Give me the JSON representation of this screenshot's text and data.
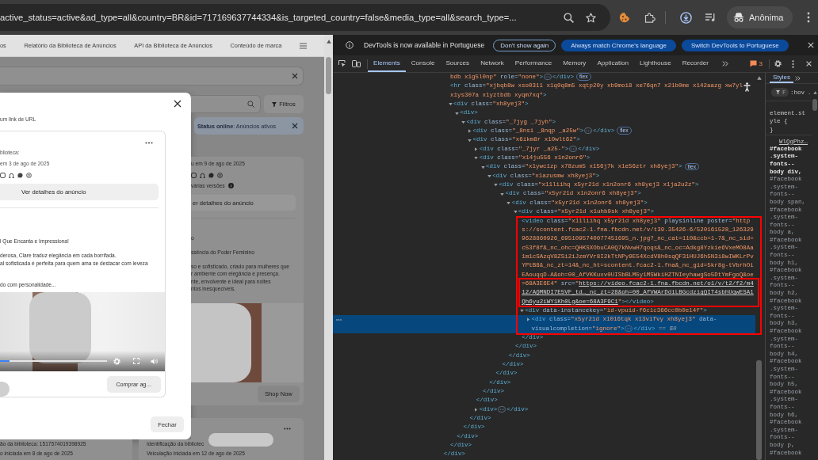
{
  "browser": {
    "url": "active_status=active&ad_type=all&country=BR&id=717169637744334&is_targeted_country=false&media_type=all&search_type=...",
    "profile": "Anônima"
  },
  "page": {
    "nav": [
      "os",
      "Relatório da Biblioteca de Anúncios",
      "API da Biblioteca de Anúncios",
      "Conteúdo de marca"
    ],
    "filters_button": "Filtros",
    "status_chip": "**Status online**: Anúncios ativos",
    "dialog": {
      "subtitle": "um link de URL",
      "ad": {
        "info_lines": [
          "blioteca:",
          "em 3 de ago de 2025"
        ],
        "details_button": "Ver detalhes do anúncio",
        "headline": "l Que Encanta e Impressiona!",
        "paragraphs": [
          [
            "derosa, Clare traduz elegância em cada borrifada.",
            "al sofisticada é perfeita para quem ama se destacar com leveza"
          ],
          [
            "do com personalidade..."
          ]
        ],
        "video_progress": {
          "level": 0.09
        },
        "cta_button": "Comprar ag…"
      },
      "close_button": "Fechar"
    },
    "background_ad": {
      "info_lines": [
        "u em 9 de ago de 2025"
      ],
      "versions_note": "várias versões",
      "details_button": "er detalhes do anúncio",
      "headline_lines": [
        "o",
        "ssência do Poder Feminino"
      ],
      "body_lines": [
        "so e sofisticado, criado para mulheres que",
        "r ambiente com elegância e presença.",
        "nte, envolvente e ideal para noites",
        "ntos inesquecíveis."
      ],
      "cta_button": "Shop Now"
    },
    "lower_cards": [
      {
        "lines": [
          "ão da biblioteca: 1517574019398925",
          "o iniciada em 8 de ago de 2025"
        ]
      },
      {
        "lines": [
          "Identificação da bibliotec",
          "Veiculação iniciada em 12 de ago de 2025"
        ]
      }
    ]
  },
  "devtools": {
    "infobar": {
      "message": "DevTools is now available in Portuguese",
      "buttons": [
        {
          "label": "Don't show again",
          "kind": "outline"
        },
        {
          "label": "Always match Chrome's language",
          "kind": "filled"
        },
        {
          "label": "Switch DevTools to Portuguese",
          "kind": "filled"
        }
      ]
    },
    "tabs": [
      {
        "label": "Elements",
        "selected": true
      },
      {
        "label": "Console",
        "selected": false
      },
      {
        "label": "Sources",
        "selected": false
      },
      {
        "label": "Network",
        "selected": false
      },
      {
        "label": "Performance",
        "selected": false
      },
      {
        "label": "Memory",
        "selected": false
      },
      {
        "label": "Application",
        "selected": false
      },
      {
        "label": "Lighthouse",
        "selected": false
      },
      {
        "label": "Recorder",
        "selected": false
      }
    ],
    "issues_count": "3",
    "dom_tree": {
      "closing": "</div>",
      "children": [
        {
          "selected": false,
          "segments": [
            {
              "kind": "value",
              "text": "bdb x1g5l0np\""
            },
            {
              "kind": "attr",
              "text": " role="
            },
            {
              "kind": "value",
              "text": "\"none\""
            },
            {
              "kind": "tag",
              "text": ">"
            },
            {
              "kind": "dots",
              "text": "⋯"
            },
            {
              "kind": "tag",
              "text": "</div>"
            }
          ],
          "badge": "flex"
        },
        {
          "selected": false,
          "segments": [
            {
              "kind": "tag",
              "text": "<hr"
            },
            {
              "kind": "attr",
              "text": " class="
            },
            {
              "kind": "value",
              "text": "\"xjbqb8w xso0311 x1q0q8m5 xqtp20y xb9moi8 xe76qn7 x21b0me x142aazg xw7yl x1ys307a x1yztbdb xyqm7xq\""
            },
            {
              "kind": "tag",
              "text": ">"
            }
          ]
        },
        {
          "selected": false,
          "expanded": true,
          "segments": [
            {
              "kind": "tag",
              "text": "<div"
            },
            {
              "kind": "attr",
              "text": " class="
            },
            {
              "kind": "value",
              "text": "\"xh8yej3\""
            },
            {
              "kind": "tag",
              "text": ">"
            }
          ],
          "closing": "</div>",
          "children": [
            {
              "selected": false,
              "expanded": true,
              "segments": [
                {
                  "kind": "tag",
                  "text": "<div>"
                }
              ],
              "closing": "</div>",
              "children": [
                {
                  "selected": false,
                  "expanded": true,
                  "segments": [
                    {
                      "kind": "tag",
                      "text": "<div"
                    },
                    {
                      "kind": "attr",
                      "text": " class="
                    },
                    {
                      "kind": "value",
                      "text": "\"_7jyg _7jyh\""
                    },
                    {
                      "kind": "tag",
                      "text": ">"
                    }
                  ],
                  "closing": "</div>",
                  "children": [
                    {
                      "selected": false,
                      "expanded": false,
                      "segments": [
                        {
                          "kind": "tag",
                          "text": "<div"
                        },
                        {
                          "kind": "attr",
                          "text": " class="
                        },
                        {
                          "kind": "value",
                          "text": "\"_8nsi _8nqp _a25w\""
                        },
                        {
                          "kind": "tag",
                          "text": ">"
                        },
                        {
                          "kind": "dots",
                          "text": "⋯"
                        },
                        {
                          "kind": "tag",
                          "text": "</div>"
                        }
                      ],
                      "badge": "flex"
                    },
                    {
                      "selected": false,
                      "expanded": true,
                      "segments": [
                        {
                          "kind": "tag",
                          "text": "<div"
                        },
                        {
                          "kind": "attr",
                          "text": " class="
                        },
                        {
                          "kind": "value",
                          "text": "\"x6ikm8r x10wlt62\""
                        },
                        {
                          "kind": "tag",
                          "text": ">"
                        }
                      ],
                      "closing": "</div>",
                      "children": [
                        {
                          "selected": false,
                          "expanded": false,
                          "segments": [
                            {
                              "kind": "tag",
                              "text": "<div"
                            },
                            {
                              "kind": "attr",
                              "text": " class="
                            },
                            {
                              "kind": "value",
                              "text": "\"_7jyr _a25-\""
                            },
                            {
                              "kind": "tag",
                              "text": ">"
                            },
                            {
                              "kind": "dots",
                              "text": "⋯"
                            },
                            {
                              "kind": "tag",
                              "text": "</div>"
                            }
                          ]
                        },
                        {
                          "selected": false,
                          "expanded": true,
                          "segments": [
                            {
                              "kind": "tag",
                              "text": "<div"
                            },
                            {
                              "kind": "attr",
                              "text": " class="
                            },
                            {
                              "kind": "value",
                              "text": "\"x14ju556 x1n2onr6\""
                            },
                            {
                              "kind": "tag",
                              "text": ">"
                            }
                          ],
                          "closing": "</div>",
                          "children": [
                            {
                              "selected": false,
                              "expanded": true,
                              "segments": [
                                {
                                  "kind": "tag",
                                  "text": "<div"
                                },
                                {
                                  "kind": "attr",
                                  "text": " class="
                                },
                                {
                                  "kind": "value",
                                  "text": "\"x1ywc1zp x78zum5 x156j7k x1e56ztr xh8yej3\""
                                },
                                {
                                  "kind": "tag",
                                  "text": ">"
                                }
                              ],
                              "badge": "flex",
                              "closing": "</div>",
                              "children": [
                                {
                                  "selected": false,
                                  "expanded": true,
                                  "segments": [
                                    {
                                      "kind": "tag",
                                      "text": "<div"
                                    },
                                    {
                                      "kind": "attr",
                                      "text": " class="
                                    },
                                    {
                                      "kind": "value",
                                      "text": "\"x1azusmw xh8yej3\""
                                    },
                                    {
                                      "kind": "tag",
                                      "text": ">"
                                    }
                                  ],
                                  "closing": "</div>",
                                  "children": [
                                    {
                                      "selected": false,
                                      "expanded": true,
                                      "segments": [
                                        {
                                          "kind": "tag",
                                          "text": "<div"
                                        },
                                        {
                                          "kind": "attr",
                                          "text": " class="
                                        },
                                        {
                                          "kind": "value",
                                          "text": "\"x11liihq x5yr21d x1n2onr6 xh8yej3 x1ja2u2z\""
                                        },
                                        {
                                          "kind": "tag",
                                          "text": ">"
                                        }
                                      ],
                                      "closing": "</div>",
                                      "children": [
                                        {
                                          "selected": false,
                                          "expanded": true,
                                          "segments": [
                                            {
                                              "kind": "tag",
                                              "text": "<div"
                                            },
                                            {
                                              "kind": "attr",
                                              "text": " class="
                                            },
                                            {
                                              "kind": "value",
                                              "text": "\"x5yr21d x1n2onr6 xh8yej3\""
                                            },
                                            {
                                              "kind": "tag",
                                              "text": ">"
                                            }
                                          ],
                                          "closing": "</div>",
                                          "children": [
                                            {
                                              "selected": false,
                                              "expanded": true,
                                              "segments": [
                                                {
                                                  "kind": "tag",
                                                  "text": "<div"
                                                },
                                                {
                                                  "kind": "attr",
                                                  "text": " class="
                                                },
                                                {
                                                  "kind": "value",
                                                  "text": "\"x5yr21d x1n2onr6 xh8yej3\""
                                                },
                                                {
                                                  "kind": "tag",
                                                  "text": ">"
                                                }
                                              ],
                                              "closing": "</div>",
                                              "children": [
                                                {
                                                  "selected": false,
                                                  "expanded": true,
                                                  "segments": [
                                                    {
                                                      "kind": "tag",
                                                      "text": "<div"
                                                    },
                                                    {
                                                      "kind": "attr",
                                                      "text": " class="
                                                    },
                                                    {
                                                      "kind": "value",
                                                      "text": "\"x5yr21d x1uhb9sk xh8yej3\""
                                                    },
                                                    {
                                                      "kind": "tag",
                                                      "text": ">"
                                                    }
                                                  ],
                                                  "closing": "</div>",
                                                  "children": [
                                                    {
                                                      "selected": false,
                                                      "segments": [
                                                        {
                                                          "kind": "tag",
                                                          "text": "<video"
                                                        },
                                                        {
                                                          "kind": "attr",
                                                          "text": " class="
                                                        },
                                                        {
                                                          "kind": "value",
                                                          "text": "\"x11liihq x5yr21d xh8yej3\""
                                                        },
                                                        {
                                                          "kind": "attr",
                                                          "text": " playsinline"
                                                        },
                                                        {
                                                          "kind": "attr",
                                                          "text": " poster="
                                                        },
                                                        {
                                                          "kind": "url",
                                                          "text": "\"https://scontent.fcac2-1.fna.fbcdn.net/v/t39.35426-6/520161528_1263299628860926_6951095740077451695_n.jpg?_nc_cat=110&ccb=1-7&_nc_sid=c53f8f&_nc_ohc=QHKSXObuCA0Q7kNvwH7qoqs&_nc_oc=Adkg8Yzkie6VxeMO8Aa1m1cSAzqV8ZSi2iJzmYVr8I2kTtNPy9E54XcdV8h0sqQF31HUJ6h5N3i8wIWKLrPvYPtB8&_nc_zt=14&_nc_ht=scontent.fcac2-1.fna&_nc_gid=5kr8g-tVbrhOiEAouqqD-A&oh=00_AfVKKuxv0UISbBLM5y1MSWkiHZTNIeyhawgSo5DtYmFgoQ&oe=68A3E6E4\""
                                                        },
                                                        {
                                                          "kind": "attr",
                                                          "text": " src="
                                                        },
                                                        {
                                                          "kind": "value",
                                                          "text": "\""
                                                        },
                                                        {
                                                          "kind": "link",
                                                          "text": "https://video.fcac2-1.fna.fbcdn.net/o1/v/t2/f2/m412/AQMNDI7E5VF_td…_nc_zt=28&oh=00_AfVWArDdiLBGcdzigQIT4sbhUgwESA1Qh6yu2iWY1Kh0Lg&oe=68A3F9C1"
                                                        },
                                                        {
                                                          "kind": "value",
                                                          "text": "\""
                                                        },
                                                        {
                                                          "kind": "tag",
                                                          "text": "></video>"
                                                        }
                                                      ]
                                                    },
                                                    {
                                                      "selected": false,
                                                      "expanded": true,
                                                      "segments": [
                                                        {
                                                          "kind": "tag",
                                                          "text": "<div"
                                                        },
                                                        {
                                                          "kind": "attr",
                                                          "text": " data-instancekey="
                                                        },
                                                        {
                                                          "kind": "value",
                                                          "text": "\"id-vpuid-f6c1c366cc0b0e14f\""
                                                        },
                                                        {
                                                          "kind": "tag",
                                                          "text": ">"
                                                        }
                                                      ],
                                                      "closing": "</div>",
                                                      "children": [
                                                        {
                                                          "selected": true,
                                                          "expanded": false,
                                                          "segments": [
                                                            {
                                                              "kind": "tag",
                                                              "text": "<div"
                                                            },
                                                            {
                                                              "kind": "attr",
                                                              "text": " class="
                                                            },
                                                            {
                                                              "kind": "value",
                                                              "text": "\"x5yr21d x1016tqk x13vifvy xh8yej3\""
                                                            },
                                                            {
                                                              "kind": "attr",
                                                              "text": " data-visualcompletion="
                                                            },
                                                            {
                                                              "kind": "value",
                                                              "text": "\"ignore\""
                                                            },
                                                            {
                                                              "kind": "tag",
                                                              "text": ">"
                                                            },
                                                            {
                                                              "kind": "dots",
                                                              "text": "⋯"
                                                            },
                                                            {
                                                              "kind": "tag",
                                                              "text": "</div>"
                                                            },
                                                            {
                                                              "kind": "hint",
                                                              "text": " == $0"
                                                            }
                                                          ]
                                                        }
                                                      ]
                                                    }
                                                  ]
                                                }
                                              ]
                                            }
                                          ]
                                        }
                                      ]
                                    }
                                  ]
                                }
                              ]
                            }
                          ]
                        },
                        {
                          "selected": false,
                          "expanded": false,
                          "segments": [
                            {
                              "kind": "tag",
                              "text": "<div>"
                            },
                            {
                              "kind": "dots",
                              "text": "⋯"
                            },
                            {
                              "kind": "tag",
                              "text": "</div>"
                            }
                          ]
                        }
                      ]
                    }
                  ]
                }
              ]
            }
          ]
        }
      ]
    },
    "styles": {
      "tabs": [
        {
          "label": "Styles",
          "selected": true
        }
      ],
      "filter_placeholder": "F",
      "toggles": [
        ":hov",
        "."
      ],
      "element_style": {
        "open": "element.style {",
        "close": "}"
      },
      "source_link": "WlQgPhz…",
      "selectors": "**#facebook .system-fonts--body div,** #facebook .system-fonts--body span, #facebook .system-fonts--body a, #facebook .system-fonts--body h1, #facebook .system-fonts--body h2, #facebook .system-fonts--body h3, #facebook .system-fonts--body h4, #facebook .system-fonts--body h5, #facebook .system-fonts--body h6, #facebook .system-fonts--body p, #facebook"
    }
  }
}
